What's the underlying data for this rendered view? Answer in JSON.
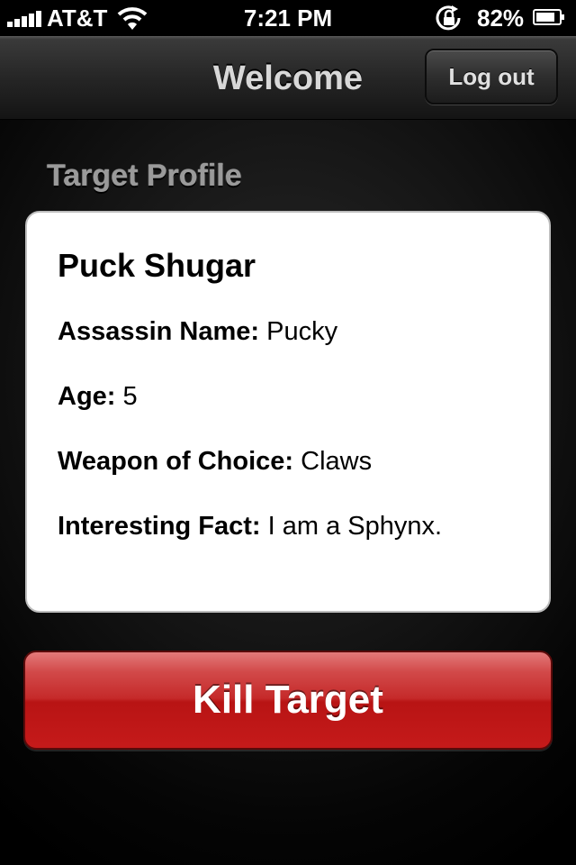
{
  "status_bar": {
    "carrier": "AT&T",
    "time": "7:21 PM",
    "battery_percent": "82%"
  },
  "nav": {
    "title": "Welcome",
    "logout_label": "Log out"
  },
  "section_title": "Target Profile",
  "profile": {
    "name": "Puck Shugar",
    "fields": [
      {
        "label": "Assassin Name:",
        "value": "Pucky"
      },
      {
        "label": "Age:",
        "value": "5"
      },
      {
        "label": "Weapon of Choice:",
        "value": "Claws"
      },
      {
        "label": "Interesting Fact:",
        "value": "I am a Sphynx."
      }
    ]
  },
  "action": {
    "kill_label": "Kill Target"
  },
  "colors": {
    "kill_button": "#c52a2a",
    "card_background": "#ffffff"
  }
}
